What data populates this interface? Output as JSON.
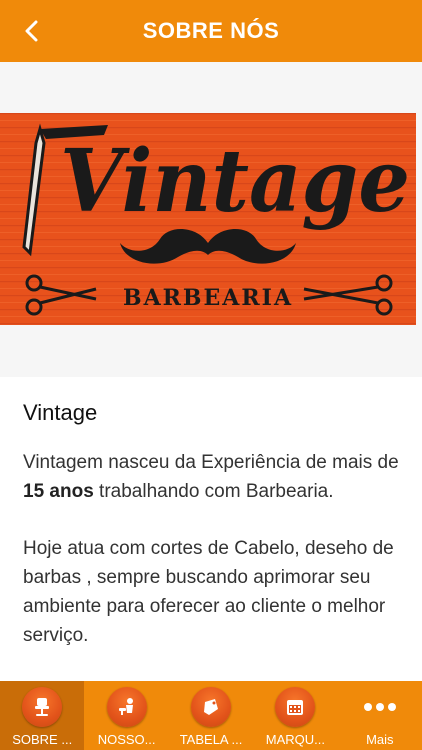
{
  "header": {
    "title": "SOBRE NÓS",
    "back_icon": "chevron-left-icon"
  },
  "banner": {
    "logo_text": "Vintage",
    "logo_subtext": "BARBEARIA",
    "colors": {
      "wood": "#e8521c",
      "ink": "#1a1a1a"
    }
  },
  "content": {
    "title": "Vintage",
    "p1_before": "Vintagem nasceu da Experiência de mais de ",
    "p1_bold": "15 anos",
    "p1_after": " trabalhando com Barbearia.",
    "p2": "Hoje atua com cortes de Cabelo, deseho de barbas , sempre buscando aprimorar seu ambiente para oferecer ao cliente o melhor serviço."
  },
  "tabbar": {
    "items": [
      {
        "label": "SOBRE ...",
        "icon": "chair-icon",
        "active": true
      },
      {
        "label": "NOSSO...",
        "icon": "barber-icon",
        "active": false
      },
      {
        "label": "TABELA ...",
        "icon": "price-tag-icon",
        "active": false
      },
      {
        "label": "MARQU...",
        "icon": "calendar-icon",
        "active": false
      },
      {
        "label": "Mais",
        "icon": "more-icon",
        "active": false
      }
    ]
  },
  "colors": {
    "accent": "#f08a0a",
    "accent_dark": "#c96d08",
    "icon_circle": "#e2531a"
  }
}
